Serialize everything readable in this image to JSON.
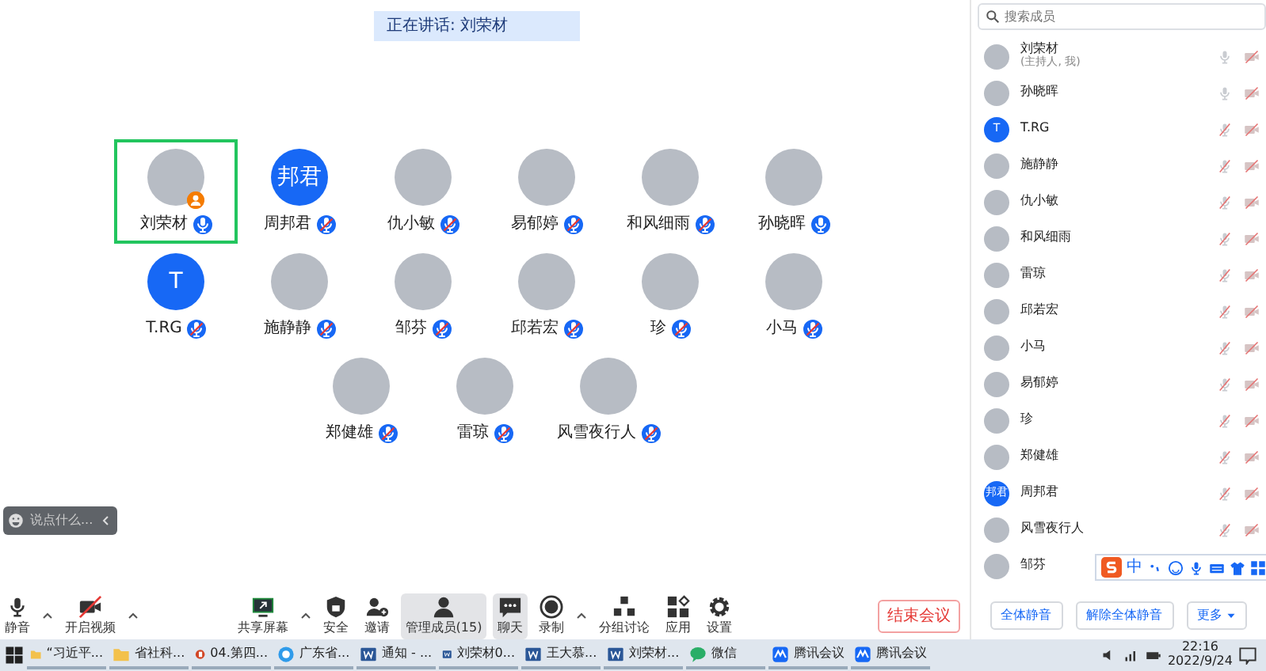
{
  "speaking_banner": "正在讲话: 刘荣材",
  "grid": [
    {
      "name": "刘荣材",
      "avatar": {
        "kind": "photo"
      },
      "muted": false,
      "speaking": true,
      "host": true
    },
    {
      "name": "周邦君",
      "avatar": {
        "kind": "initials",
        "text": "邦君"
      },
      "muted": true,
      "speaking": false,
      "host": false
    },
    {
      "name": "仇小敏",
      "avatar": {
        "kind": "photo"
      },
      "muted": true,
      "speaking": false,
      "host": false
    },
    {
      "name": "易郁婷",
      "avatar": {
        "kind": "photo"
      },
      "muted": true,
      "speaking": false,
      "host": false
    },
    {
      "name": "和风细雨",
      "avatar": {
        "kind": "photo"
      },
      "muted": true,
      "speaking": false,
      "host": false
    },
    {
      "name": "孙晓晖",
      "avatar": {
        "kind": "photo"
      },
      "muted": false,
      "speaking": false,
      "host": false
    },
    {
      "name": "T.RG",
      "avatar": {
        "kind": "initials",
        "text": "T"
      },
      "muted": true,
      "speaking": false,
      "host": false
    },
    {
      "name": "施静静",
      "avatar": {
        "kind": "photo"
      },
      "muted": true,
      "speaking": false,
      "host": false
    },
    {
      "name": "邹芬",
      "avatar": {
        "kind": "photo"
      },
      "muted": true,
      "speaking": false,
      "host": false
    },
    {
      "name": "邱若宏",
      "avatar": {
        "kind": "photo"
      },
      "muted": true,
      "speaking": false,
      "host": false
    },
    {
      "name": "珍",
      "avatar": {
        "kind": "photo"
      },
      "muted": true,
      "speaking": false,
      "host": false
    },
    {
      "name": "小马",
      "avatar": {
        "kind": "photo"
      },
      "muted": true,
      "speaking": false,
      "host": false
    },
    {
      "name": "郑健雄",
      "avatar": {
        "kind": "photo"
      },
      "muted": true,
      "speaking": false,
      "host": false
    },
    {
      "name": "雷琼",
      "avatar": {
        "kind": "photo"
      },
      "muted": true,
      "speaking": false,
      "host": false
    },
    {
      "name": "风雪夜行人",
      "avatar": {
        "kind": "photo"
      },
      "muted": true,
      "speaking": false,
      "host": false
    }
  ],
  "chat_input": {
    "placeholder": "说点什么..."
  },
  "toolbar": [
    {
      "label": "静音",
      "kind": "mic",
      "caret": true,
      "highlighted": false
    },
    {
      "label": "开启视频",
      "kind": "video",
      "caret": true,
      "highlighted": false
    },
    {
      "label": "共享屏幕",
      "kind": "share",
      "caret": true,
      "highlighted": false
    },
    {
      "label": "安全",
      "kind": "security",
      "caret": false,
      "highlighted": false
    },
    {
      "label": "邀请",
      "kind": "invite",
      "caret": false,
      "highlighted": false
    },
    {
      "label": "管理成员(15)",
      "kind": "members",
      "caret": false,
      "highlighted": true
    },
    {
      "label": "聊天",
      "kind": "chat",
      "caret": false,
      "highlighted": true
    },
    {
      "label": "录制",
      "kind": "record",
      "caret": true,
      "highlighted": false
    },
    {
      "label": "分组讨论",
      "kind": "breakout",
      "caret": false,
      "highlighted": false
    },
    {
      "label": "应用",
      "kind": "apps",
      "caret": false,
      "highlighted": false
    },
    {
      "label": "设置",
      "kind": "settings",
      "caret": false,
      "highlighted": false
    }
  ],
  "end_button": "结束会议",
  "member_panel": {
    "search": {
      "placeholder": "搜索成员"
    },
    "members": [
      {
        "name": "刘荣材",
        "role": "(主持人, 我)",
        "avatar": {
          "kind": "photo"
        },
        "muted": false
      },
      {
        "name": "孙晓晖",
        "avatar": {
          "kind": "photo"
        },
        "muted": false
      },
      {
        "name": "T.RG",
        "avatar": {
          "kind": "initials",
          "text": "T"
        },
        "muted": true
      },
      {
        "name": "施静静",
        "avatar": {
          "kind": "photo"
        },
        "muted": true
      },
      {
        "name": "仇小敏",
        "avatar": {
          "kind": "photo"
        },
        "muted": true
      },
      {
        "name": "和风细雨",
        "avatar": {
          "kind": "photo"
        },
        "muted": true
      },
      {
        "name": "雷琼",
        "avatar": {
          "kind": "photo"
        },
        "muted": true
      },
      {
        "name": "邱若宏",
        "avatar": {
          "kind": "photo"
        },
        "muted": true
      },
      {
        "name": "小马",
        "avatar": {
          "kind": "photo"
        },
        "muted": true
      },
      {
        "name": "易郁婷",
        "avatar": {
          "kind": "photo"
        },
        "muted": true
      },
      {
        "name": "珍",
        "avatar": {
          "kind": "photo"
        },
        "muted": true
      },
      {
        "name": "郑健雄",
        "avatar": {
          "kind": "photo"
        },
        "muted": true
      },
      {
        "name": "周邦君",
        "avatar": {
          "kind": "initials",
          "text": "邦君"
        },
        "muted": true
      },
      {
        "name": "风雪夜行人",
        "avatar": {
          "kind": "photo"
        },
        "muted": true
      },
      {
        "name": "邹芬",
        "avatar": {
          "kind": "photo"
        }
      }
    ],
    "buttons": [
      {
        "label": "全体静音",
        "caret": false
      },
      {
        "label": "解除全体静音",
        "caret": false
      },
      {
        "label": "更多",
        "caret": true
      }
    ]
  },
  "ime_toolbar": {
    "mode": "中"
  },
  "taskbar": {
    "items": [
      {
        "label": "“习近平...",
        "kind": "folder"
      },
      {
        "label": "省社科...",
        "kind": "folder"
      },
      {
        "label": "04.第四...",
        "kind": "slides"
      },
      {
        "label": "广东省...",
        "kind": "browser"
      },
      {
        "label": "通知 - ...",
        "kind": "doc"
      },
      {
        "label": "刘荣材0...",
        "kind": "doc"
      },
      {
        "label": "王大慕...",
        "kind": "doc"
      },
      {
        "label": "刘荣材...",
        "kind": "doc"
      },
      {
        "label": "微信",
        "kind": "messenger"
      },
      {
        "label": "腾讯会议",
        "kind": "meeting"
      },
      {
        "label": "腾讯会议",
        "kind": "meeting"
      }
    ],
    "time": "22:16",
    "date": "2022/9/24"
  }
}
